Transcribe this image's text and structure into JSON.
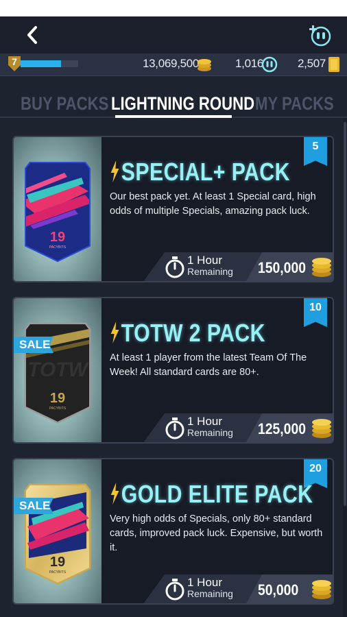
{
  "nav": {
    "back_icon": "chevron-left-icon",
    "friend_icon": "add-friend-icon"
  },
  "currency": {
    "level": "7",
    "xp_progress": 0.7,
    "coins": "13,069,500",
    "points": "1,016",
    "cards": "2,507"
  },
  "tabs": [
    {
      "label": "BUY PACKS",
      "active": false
    },
    {
      "label": "LIGHTNING ROUND",
      "active": true
    },
    {
      "label": "MY PACKS",
      "active": false
    }
  ],
  "packs": [
    {
      "title": "SPECIAL+ PACK",
      "description": "Our best pack yet. At least 1 Special card, high odds of multiple Specials, amazing pack luck.",
      "badge": "5",
      "sale": false,
      "time_value": "1 Hour",
      "time_label": "Remaining",
      "price": "150,000",
      "pack_number": "19",
      "pack_brand": "PACYBITS",
      "style": "special"
    },
    {
      "title": "TOTW 2 PACK",
      "description": "At least 1 player from the latest Team Of The Week! All standard cards are 80+.",
      "badge": "10",
      "sale": true,
      "sale_label": "SALE",
      "time_value": "1 Hour",
      "time_label": "Remaining",
      "price": "125,000",
      "pack_number": "19",
      "pack_brand": "PACYBITS",
      "pack_watermark": "TOTW",
      "style": "totw"
    },
    {
      "title": "GOLD ELITE PACK",
      "description": "Very high odds of Specials, only 80+ standard cards, improved pack luck. Expensive, but worth it.",
      "badge": "20",
      "sale": true,
      "sale_label": "SALE",
      "time_value": "1 Hour",
      "time_label": "Remaining",
      "price": "50,000",
      "pack_number": "19",
      "pack_brand": "PACYBITS",
      "style": "gold"
    }
  ],
  "colors": {
    "background": "#1e2330",
    "accent": "#1f9ee0",
    "title_glow": "#98f0f4",
    "coin_gold": "#e8b829"
  }
}
